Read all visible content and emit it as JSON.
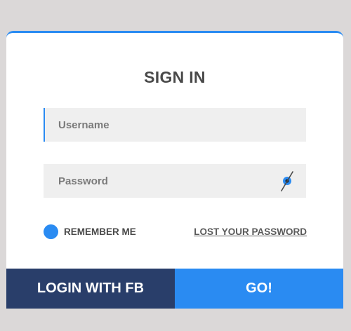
{
  "form": {
    "title": "SIGN IN",
    "username_placeholder": "Username",
    "password_placeholder": "Password",
    "remember_label": "REMEMBER ME",
    "remember_checked": true,
    "lost_password_label": "LOST YOUR PASSWORD",
    "fb_button_label": "LOGIN WITH FB",
    "go_button_label": "GO!"
  },
  "colors": {
    "accent": "#2a8bf2",
    "fb_button": "#293e6a",
    "background": "#dbd8d8",
    "field_background": "#efefef"
  },
  "icons": {
    "password_toggle": "eye-slash-icon",
    "remember": "radio-filled-icon"
  }
}
